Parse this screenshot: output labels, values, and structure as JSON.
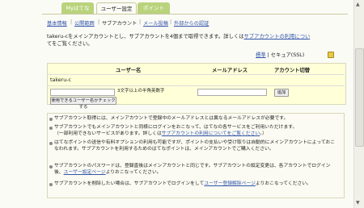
{
  "tabs": [
    {
      "label": "Myはてな",
      "active": false
    },
    {
      "label": "ユーザー設定",
      "active": true
    },
    {
      "label": "ポイント",
      "active": false
    }
  ],
  "subnav": [
    "基本情報",
    "公開範囲",
    "サブアカウント",
    "メール投稿",
    "外部からの認証"
  ],
  "intro": {
    "line1_prefix": "takeru-cをメインアカウントとし、サブアカウントを4個まで取得できます。詳しくは",
    "link": "サブアカウントの利用につい",
    "line2": "てをご覧ください。"
  },
  "security": {
    "standard": "標準",
    "ssl": "セキュア(SSL)"
  },
  "table": {
    "col_user": "ユーザー名",
    "col_mail": "メールアドレス",
    "col_switch": "アカウント切替",
    "main_user": "takeru-c",
    "hint": "3文字以上の半角英数字",
    "add_button": "追加",
    "check_button": "使用できるユーザー名かチェックする"
  },
  "notes": [
    {
      "text": "サブアカウント取得には、メインアカウントで登録中のメールアドレスとは異なるメールアドレスが必要です。"
    },
    {
      "text": "サブアカウントでもメインアカウントと同様にログインをおこなって、はてなの各サービスをご利用いただけます。",
      "sub_prefix": "（一部利用できないサービスがあります。詳しくは",
      "sub_link": "サブアカウントの利用についてをご覧ください",
      "sub_suffix": "。）"
    },
    {
      "text": "はてなポイントの送信や有料オプションの利用も可能ですが、ポイントの支払いや受け取りは自動的にメインアカウントによっておこなわれます。サブアカウントを利用するためのはてなポイントは、メインアカウントでご購入ください。"
    },
    {
      "text": "サブアカウントのパスワードは、登録直後はメインアカウントと同じです。サブアカウントの設定変更は、各アカウントでログイン後、",
      "link": "ユーザー設定ページ",
      "suffix": "よりおこなってください。"
    },
    {
      "text": "サブアカウントを削除したい場合は、サブアカウントでログインをして",
      "link": "ユーザー登録解除ページ",
      "suffix": "よりおこなってください。"
    }
  ]
}
